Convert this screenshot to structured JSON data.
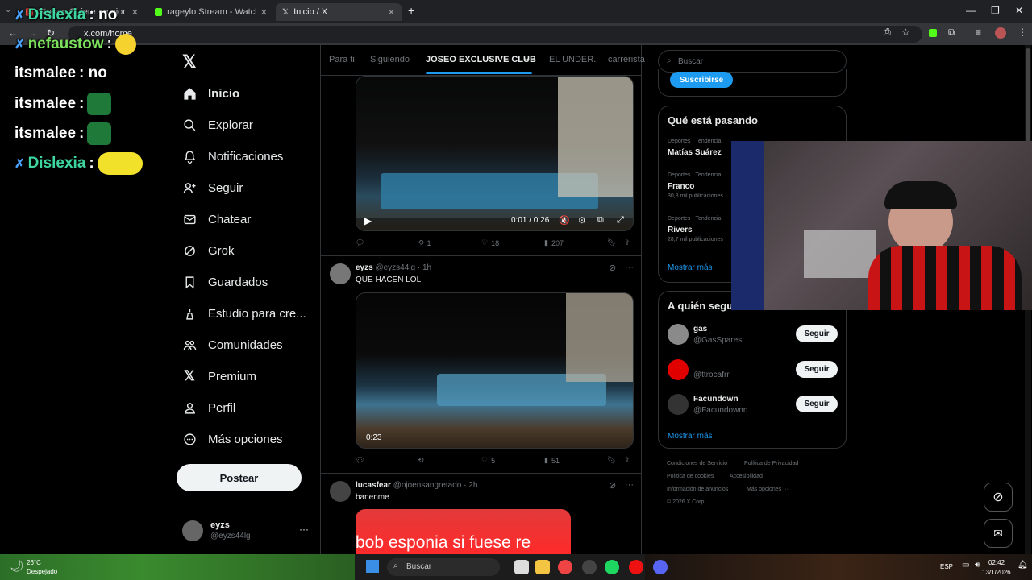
{
  "browser": {
    "tabs": [
      {
        "label": "Stream Quiere - mejor para m",
        "active": false
      },
      {
        "label": "rageylo Stream - Watch Live on",
        "active": false
      },
      {
        "label": "Inicio / X",
        "active": true
      }
    ],
    "url": "x.com/home"
  },
  "chat": [
    {
      "user": "Dislexia",
      "message": ": no"
    },
    {
      "user": "nefaustow",
      "message": ":"
    },
    {
      "user": "itsmalee",
      "message": ": no"
    },
    {
      "user": "itsmalee",
      "message": ":"
    },
    {
      "user": "itsmalee",
      "message": ":"
    },
    {
      "user": "Dislexia",
      "message": ":"
    }
  ],
  "sidebar": {
    "items": [
      {
        "label": "Inicio",
        "icon": "home-icon"
      },
      {
        "label": "Explorar",
        "icon": "search-icon"
      },
      {
        "label": "Notificaciones",
        "icon": "bell-icon"
      },
      {
        "label": "Seguir",
        "icon": "person-plus-icon"
      },
      {
        "label": "Chatear",
        "icon": "mail-icon"
      },
      {
        "label": "Grok",
        "icon": "grok-icon"
      },
      {
        "label": "Guardados",
        "icon": "bookmark-icon"
      },
      {
        "label": "Estudio para cre...",
        "icon": "studio-icon"
      },
      {
        "label": "Comunidades",
        "icon": "communities-icon"
      },
      {
        "label": "Premium",
        "icon": "x-logo-icon"
      },
      {
        "label": "Perfil",
        "icon": "profile-icon"
      },
      {
        "label": "Más opciones",
        "icon": "more-icon"
      }
    ],
    "post_label": "Postear",
    "account": {
      "name": "eyzs",
      "handle": "@eyzs44lg",
      "more": "···"
    }
  },
  "feed": {
    "tabs": [
      "Para ti",
      "Siguiendo",
      "JOSEO EXCLUSIVE CLUB",
      "EL UNDER.",
      "carrerista"
    ],
    "post1": {
      "time": "0:01 / 0:26",
      "stats": {
        "reply": "",
        "retweet": "1",
        "like": "18",
        "views": "207"
      }
    },
    "post2": {
      "name": "eyzs",
      "handle": "@eyzs44lg",
      "time": "· 1h",
      "text": "QUE HACEN LOL",
      "duration": "0:23",
      "stats": {
        "reply": "",
        "retweet": "",
        "like": "5",
        "views": "51"
      }
    },
    "post3": {
      "name": "lucasfear",
      "handle": "@ojoensangretado",
      "time": "· 2h",
      "text": "banenme",
      "media_text": "bob esponia si fuese re"
    }
  },
  "right": {
    "search_placeholder": "Buscar",
    "subscribe": "Suscribirse",
    "trending_title": "Qué está pasando",
    "trends": [
      {
        "meta": "Deportes · Tendencia",
        "name": "Matías Suárez",
        "count": ""
      },
      {
        "meta": "Deportes · Tendencia",
        "name": "Franco",
        "count": "30,8 mil publicaciones"
      },
      {
        "meta": "Deportes · Tendencia",
        "name": "Rivers",
        "count": "28,7 mil publicaciones"
      }
    ],
    "show_more": "Mostrar más",
    "who_title": "A quién seguir",
    "who": [
      {
        "name": "gas",
        "handle": "@GasSpares",
        "button": "Seguir"
      },
      {
        "name": "",
        "handle": "@ttrocafrr",
        "button": "Seguir"
      },
      {
        "name": "Facundown",
        "handle": "@Facundownn",
        "button": "Seguir"
      }
    ],
    "show_more2": "Mostrar más",
    "footer": [
      "Condiciones de Servicio",
      "Política de Privacidad",
      "Política de cookies",
      "Accesibilidad",
      "Información de anuncios",
      "Más opciones ···",
      "© 2026 X Corp."
    ]
  },
  "taskbar": {
    "temp": "26°C",
    "weather": "Despejado",
    "search": "Buscar",
    "lang": "ESP",
    "time": "02:42",
    "date": "13/1/2026"
  }
}
